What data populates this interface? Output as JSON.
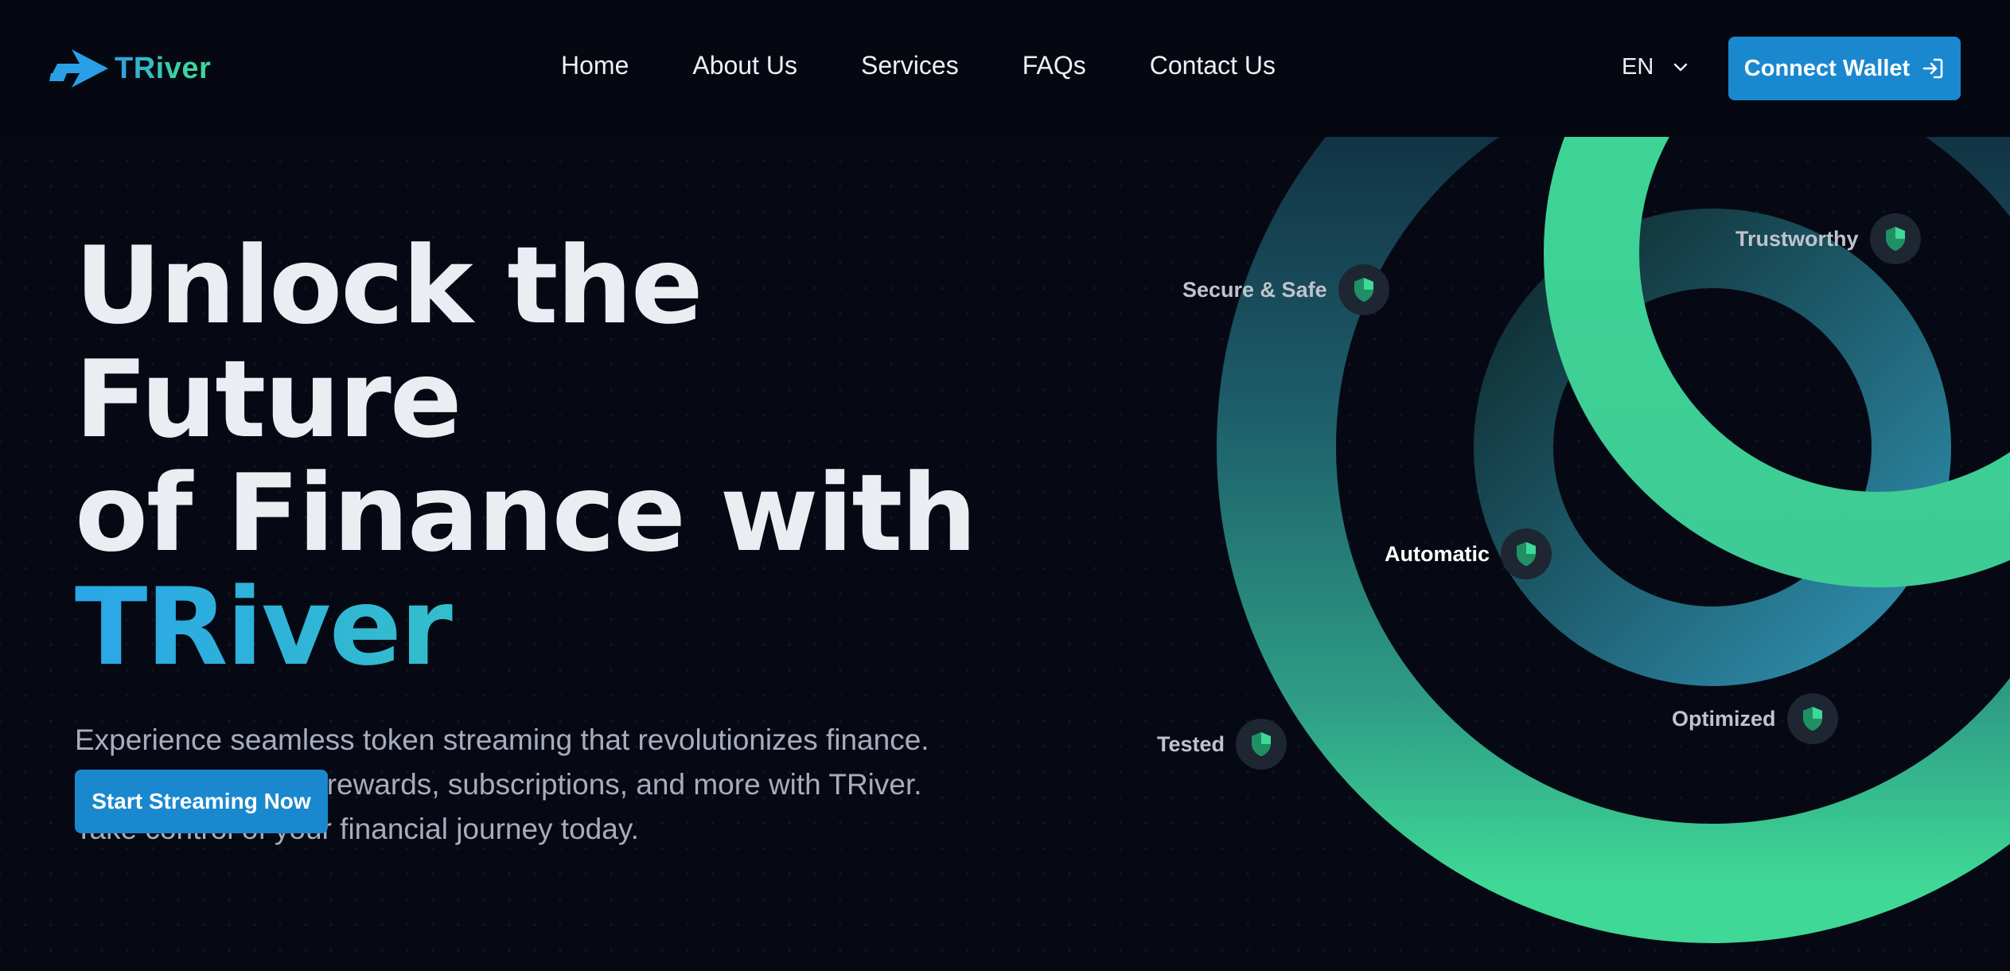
{
  "brand": {
    "name": "TRiver"
  },
  "nav": {
    "items": [
      {
        "label": "Home"
      },
      {
        "label": "About Us"
      },
      {
        "label": "Services"
      },
      {
        "label": "FAQs"
      },
      {
        "label": "Contact Us"
      }
    ],
    "language": "EN",
    "wallet_button": "Connect Wallet"
  },
  "hero": {
    "title_line1": "Unlock the Future",
    "title_line2": "of Finance with",
    "title_brand": "TRiver",
    "subtitle_line1": "Experience seamless token streaming that revolutionizes finance.",
    "subtitle_line2": "Automate salaries, rewards, subscriptions, and more with TRiver.",
    "subtitle_line3": "Take control of your financial journey today.",
    "cta": "Start Streaming Now"
  },
  "features": [
    {
      "label": "Trustworthy"
    },
    {
      "label": "Secure & Safe"
    },
    {
      "label": "Automatic"
    },
    {
      "label": "Optimized"
    },
    {
      "label": "Tested"
    }
  ],
  "icons": {
    "logo": "arrow-logo-icon",
    "language": "chevron-down-icon",
    "wallet": "sign-in-icon",
    "feature": "shield-icon"
  },
  "colors": {
    "background": "#060913",
    "accent_blue": "#1a88cf",
    "accent_green": "#3fd896",
    "badge_bg": "#1e2632"
  }
}
